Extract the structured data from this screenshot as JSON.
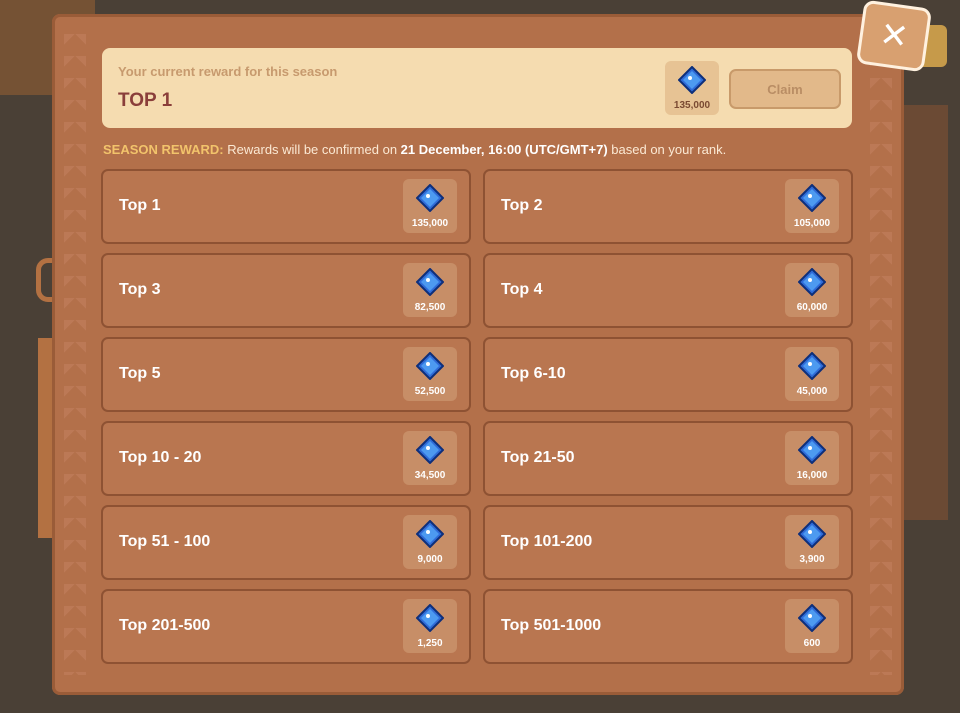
{
  "colors": {
    "panel": "#b3704a",
    "banner": "#f5dcb0",
    "rank_text": "#8a3e3a",
    "accent_yellow": "#f2c36b",
    "gem_blue": "#2f6bd8"
  },
  "icons": {
    "close": "close-icon",
    "gem": "blue-gem-icon"
  },
  "current": {
    "label": "Your current reward for this season",
    "rank": "TOP 1",
    "amount": "135,000",
    "claim": "Claim"
  },
  "season_note": {
    "lead": "SEASON REWARD:",
    "text_before": "Rewards will be confirmed on",
    "date": "21 December, 16:00 (UTC/GMT+7)",
    "text_after": "based on your rank."
  },
  "rewards": [
    {
      "rank": "Top 1",
      "amount": "135,000"
    },
    {
      "rank": "Top 2",
      "amount": "105,000"
    },
    {
      "rank": "Top 3",
      "amount": "82,500"
    },
    {
      "rank": "Top 4",
      "amount": "60,000"
    },
    {
      "rank": "Top 5",
      "amount": "52,500"
    },
    {
      "rank": "Top 6-10",
      "amount": "45,000"
    },
    {
      "rank": "Top 10 - 20",
      "amount": "34,500"
    },
    {
      "rank": "Top 21-50",
      "amount": "16,000"
    },
    {
      "rank": "Top 51 - 100",
      "amount": "9,000"
    },
    {
      "rank": "Top 101-200",
      "amount": "3,900"
    },
    {
      "rank": "Top 201-500",
      "amount": "1,250"
    },
    {
      "rank": "Top 501-1000",
      "amount": "600"
    }
  ]
}
